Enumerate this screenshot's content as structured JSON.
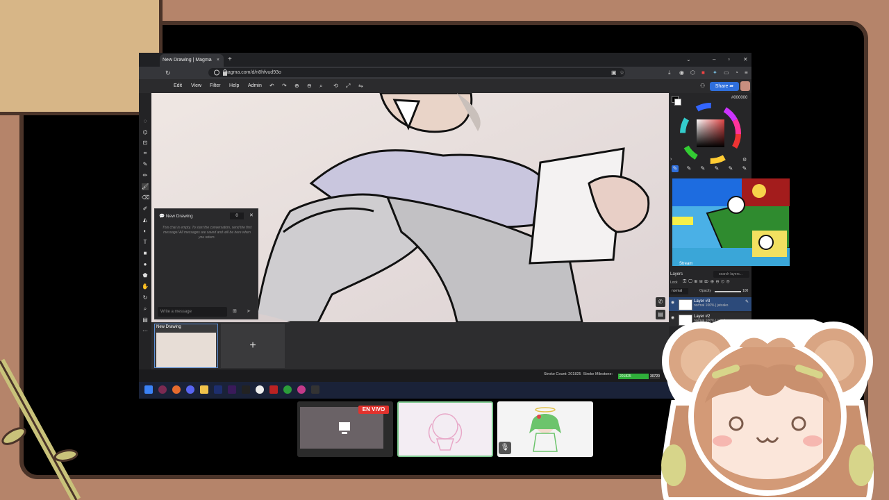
{
  "browser": {
    "tab_title": "New Drawing | Magma",
    "tab_close": "×",
    "new_tab": "+",
    "url": "magma.com/d/n8hfvud93o",
    "win_controls": [
      "⌄",
      "–",
      "▫",
      "✕"
    ]
  },
  "app": {
    "menu": [
      "Edit",
      "View",
      "Filter",
      "Help",
      "Admin"
    ],
    "share_label": "Share",
    "hex_value": "#000000",
    "layers": {
      "title": "Layers",
      "lock_label": "Lock",
      "blend": "normal",
      "opacity_label": "Opacity",
      "opacity_value": "100",
      "search_placeholder": "search layers...",
      "items": [
        {
          "name": "Layer #3",
          "meta": "normal 100% | jatzako"
        },
        {
          "name": "Layer #2",
          "meta": "normal 100% | jatzako"
        }
      ]
    },
    "chat": {
      "title": "New Drawing",
      "count": "0",
      "empty_message": "This chat is empty. To start the conversation, send the first message! All messages are saved and will be here when you return.",
      "input_placeholder": "Write a message"
    },
    "drawings": {
      "current_label": "New Drawing",
      "add_label": "+"
    },
    "status": {
      "stroke_count_label": "Stroke Count: 201825",
      "milestone_label": "Stroke Milestone:",
      "milestone_value": "201825",
      "milestone_target": "30720"
    },
    "popup_label": "Stream"
  },
  "stream": {
    "live_badge": "EN VIVO"
  },
  "colors": {
    "accent_blue": "#2f6fdc",
    "live_red": "#e1322d",
    "frame_brown": "#4b3429",
    "background": "#b5846a",
    "milestone_green": "#2fae3a"
  }
}
